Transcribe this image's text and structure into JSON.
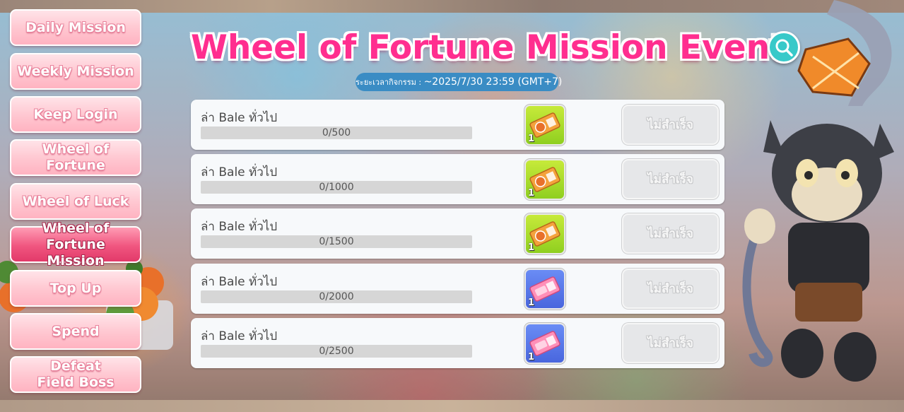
{
  "sidebar": {
    "items": [
      {
        "label": "Daily Mission"
      },
      {
        "label": "Weekly Mission"
      },
      {
        "label": "Keep Login"
      },
      {
        "label": "Wheel of Fortune"
      },
      {
        "label": "Wheel of Luck"
      },
      {
        "label": "Wheel of Fortune Mission"
      },
      {
        "label": "Top Up"
      },
      {
        "label": "Spend"
      },
      {
        "label": "Defeat Field Boss"
      }
    ],
    "active_label": "Wheel of Fortune Mission"
  },
  "header": {
    "title": "Wheel of Fortune Mission Event",
    "period_label": "ระยะเวลากิจกรรม : ",
    "period_value": "~2025/7/30 23:59 (GMT+7)"
  },
  "missions": [
    {
      "name": "ล่า Bale ทั่วไป",
      "progress_text": "0/500",
      "progress": 0,
      "reward_qty": "1",
      "reward_type": "green-ticket",
      "status": "ไม่สำเร็จ"
    },
    {
      "name": "ล่า Bale ทั่วไป",
      "progress_text": "0/1000",
      "progress": 0,
      "reward_qty": "1",
      "reward_type": "green-ticket",
      "status": "ไม่สำเร็จ"
    },
    {
      "name": "ล่า Bale ทั่วไป",
      "progress_text": "0/1500",
      "progress": 0,
      "reward_qty": "1",
      "reward_type": "green-ticket",
      "status": "ไม่สำเร็จ"
    },
    {
      "name": "ล่า Bale ทั่วไป",
      "progress_text": "0/2000",
      "progress": 0,
      "reward_qty": "1",
      "reward_type": "blue-lucky-ticket",
      "status": "ไม่สำเร็จ"
    },
    {
      "name": "ล่า Bale ทั่วไป",
      "progress_text": "0/2500",
      "progress": 0,
      "reward_qty": "1",
      "reward_type": "blue-lucky-ticket",
      "status": "ไม่สำเร็จ"
    }
  ],
  "colors": {
    "title": "#ff2e8f",
    "sidebar_active": "#f0557f",
    "sidebar_inactive": "#ffc6d0",
    "period_bg": "#3a8cc4",
    "search_button": "#38c9c9"
  },
  "icons": {
    "search": "search-icon",
    "ticket_green": "ticket-icon",
    "ticket_blue": "lucky-ticket-icon"
  }
}
